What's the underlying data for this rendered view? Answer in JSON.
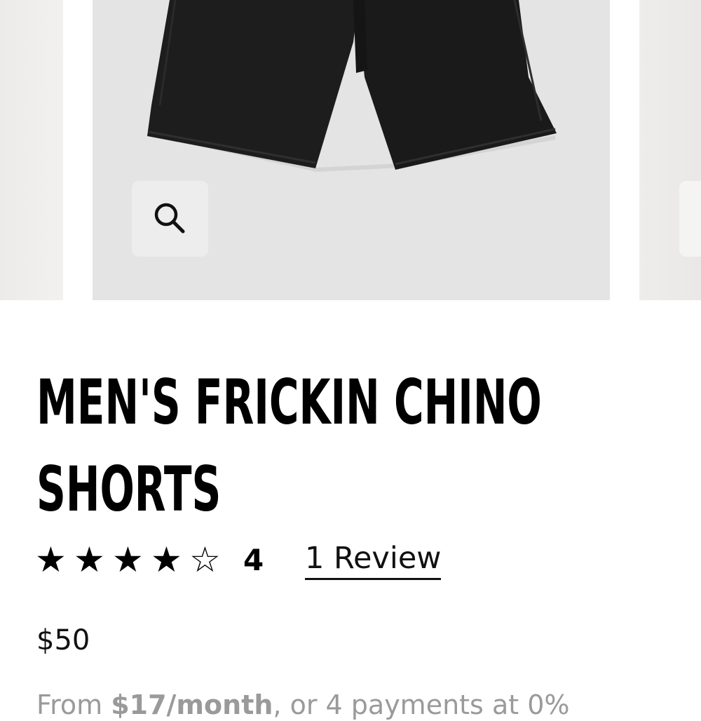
{
  "product": {
    "title": "MEN'S FRICKIN CHINO SHORTS",
    "rating": {
      "stars_filled": 4,
      "stars_total": 5,
      "value_label": "4",
      "review_link": "1 Review"
    },
    "price": "$50",
    "installments": {
      "prefix": "From ",
      "amount": "$17/month",
      "suffix": ", or 4 payments at 0%"
    }
  },
  "gallery": {
    "zoom_icon": "search-icon",
    "product_color": "#1c1c1c",
    "background_color": "#e4e4e4"
  }
}
